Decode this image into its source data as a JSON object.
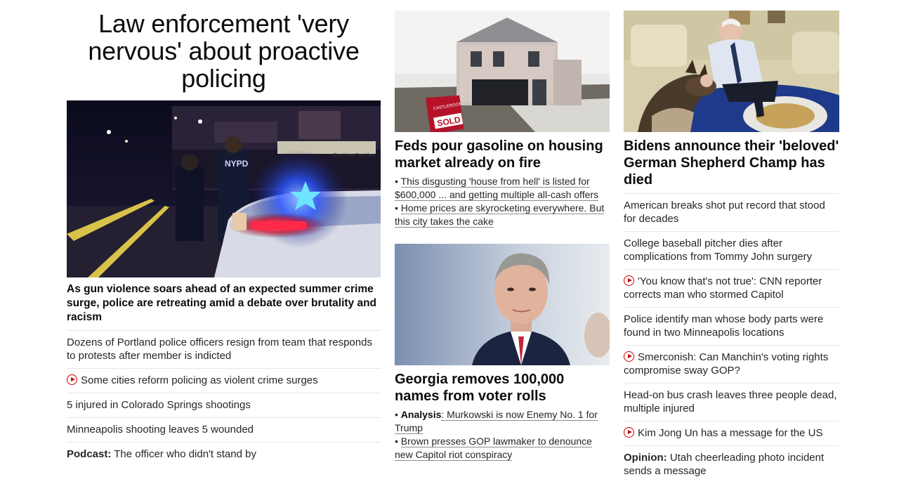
{
  "left": {
    "headline": "Law enforcement 'very nervous' about proactive policing",
    "lead": "As gun violence soars ahead of an expected summer crime surge, police are retreating amid a debate over brutality and racism",
    "image_text": {
      "car_label": "NYPD",
      "sign": "Buy Here Pay Here"
    },
    "links": [
      {
        "text": "Dozens of Portland police officers resign from team that responds to protests after member is indicted",
        "video": false
      },
      {
        "text": "Some cities reform policing as violent crime surges",
        "video": true
      },
      {
        "text": "5 injured in Colorado Springs shootings",
        "video": false
      },
      {
        "text": "Minneapolis shooting leaves 5 wounded",
        "video": false
      },
      {
        "prefix": "Podcast:",
        "text": " The officer who didn't stand by",
        "video": false
      }
    ]
  },
  "middle": {
    "card1": {
      "image_text": {
        "sign_top": "CASTLEROCK",
        "sign_bottom": "SOLD"
      },
      "title": "Feds pour gasoline on housing market already on fire",
      "bullets": [
        "This disgusting 'house from hell' is listed for $600,000 ... and getting multiple all-cash offers",
        "Home prices are skyrocketing everywhere. But this city takes the cake"
      ]
    },
    "card2": {
      "title": "Georgia removes 100,000 names from voter rolls",
      "bullets": [
        {
          "prefix": "Analysis",
          "text": ": Murkowski is now Enemy No. 1 for Trump"
        },
        {
          "prefix": "",
          "text": "Brown presses GOP lawmaker to denounce new Capitol riot conspiracy"
        }
      ]
    }
  },
  "right": {
    "title": "Bidens announce their 'beloved' German Shepherd Champ has died",
    "links": [
      {
        "text": "American breaks shot put record that stood for decades",
        "video": false
      },
      {
        "text": "College baseball pitcher dies after complications from Tommy John surgery",
        "video": false
      },
      {
        "text": "'You know that's not true': CNN reporter corrects man who stormed Capitol",
        "video": true
      },
      {
        "text": "Police identify man whose body parts were found in two Minneapolis locations",
        "video": false
      },
      {
        "text": "Smerconish: Can Manchin's voting rights compromise sway GOP?",
        "video": true
      },
      {
        "text": "Head-on bus crash leaves three people dead, multiple injured",
        "video": false
      },
      {
        "text": "Kim Jong Un has a message for the US",
        "video": true
      },
      {
        "prefix": "Opinion:",
        "text": " Utah cheerleading photo incident sends a message",
        "video": false
      }
    ]
  },
  "colors": {
    "video_icon": "#cc0000",
    "divider": "#e6e6e6",
    "text": "#262626",
    "headline": "#0c0c0c"
  }
}
